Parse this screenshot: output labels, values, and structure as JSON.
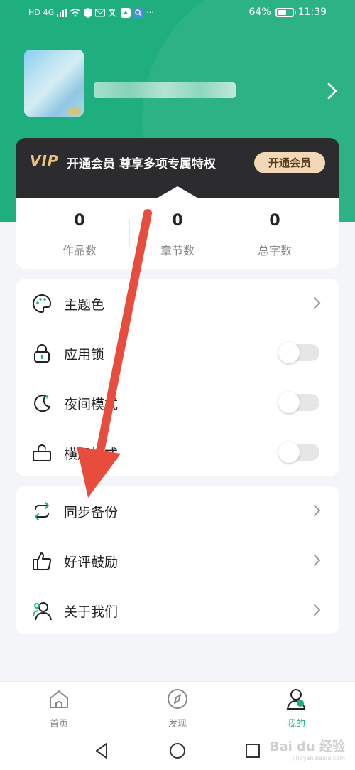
{
  "status_bar": {
    "network_labels": [
      "HD",
      "4G"
    ],
    "battery_text": "64%",
    "battery_level": 0.64,
    "time": "11:39",
    "more_indicator": "···"
  },
  "colors": {
    "accent": "#1fae7e",
    "vip_gold": "#e9c27b",
    "arrow_red": "#e74c3c"
  },
  "vip": {
    "logo": "VIP",
    "text": "开通会员  尊享多项专属特权",
    "button": "开通会员"
  },
  "stats": [
    {
      "value": "0",
      "label": "作品数"
    },
    {
      "value": "0",
      "label": "章节数"
    },
    {
      "value": "0",
      "label": "总字数"
    }
  ],
  "settings": {
    "theme": {
      "label": "主题色",
      "icon": "palette-icon"
    },
    "app_lock": {
      "label": "应用锁",
      "icon": "lock-icon",
      "enabled": false
    },
    "night_mode": {
      "label": "夜间模式",
      "icon": "moon-icon",
      "enabled": false
    },
    "landscape": {
      "label": "横屏模式",
      "icon": "landscape-icon",
      "enabled": false
    }
  },
  "more": {
    "sync": {
      "label": "同步备份",
      "icon": "sync-icon"
    },
    "rate": {
      "label": "好评鼓励",
      "icon": "thumbs-up-icon"
    },
    "about": {
      "label": "关于我们",
      "icon": "people-icon"
    }
  },
  "tabs": [
    {
      "label": "首页",
      "icon": "home-icon"
    },
    {
      "label": "发现",
      "icon": "compass-icon"
    },
    {
      "label": "我的",
      "icon": "user-icon",
      "active": true
    }
  ],
  "watermark": {
    "brand": "Bai du 经验",
    "url": "jingyan.baidu.com"
  }
}
